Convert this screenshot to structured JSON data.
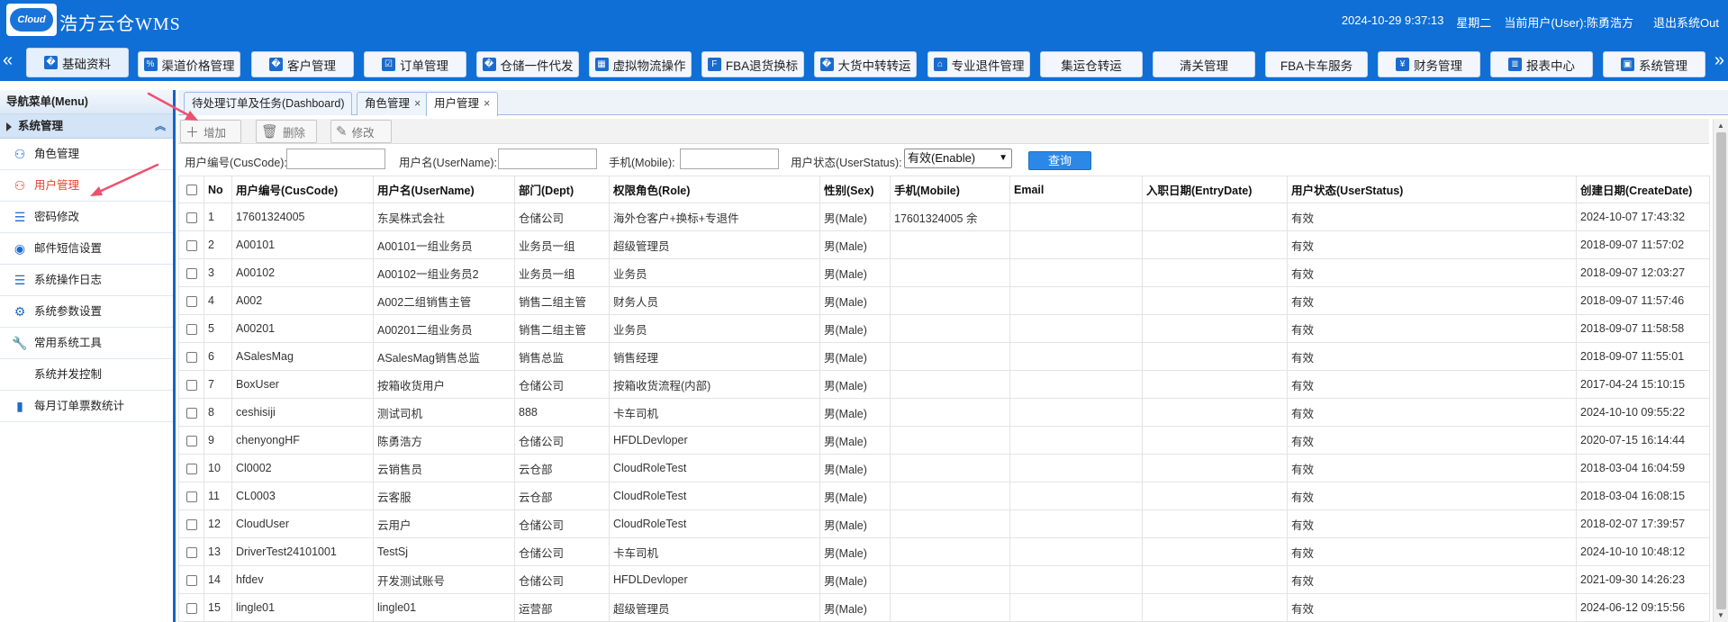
{
  "header": {
    "logo_text": "Cloud",
    "title": "浩方云仓WMS",
    "datetime": "2024-10-29 9:37:13",
    "weekday": "星期二",
    "current_user": "当前用户(User):陈勇浩方",
    "logout": "退出系统Out"
  },
  "topnav": {
    "left_arrow": "«",
    "right_arrow": "»",
    "items": [
      {
        "label": "基础资料",
        "icon": "tag-icon"
      },
      {
        "label": "渠道价格管理",
        "icon": "percent-icon"
      },
      {
        "label": "客户管理",
        "icon": "user-icon"
      },
      {
        "label": "订单管理",
        "icon": "checklist-icon"
      },
      {
        "label": "仓储一件代发",
        "icon": "globe-icon"
      },
      {
        "label": "虚拟物流操作",
        "icon": "grid-icon"
      },
      {
        "label": "FBA退货换标",
        "icon": "fba-icon"
      },
      {
        "label": "大货中转转运",
        "icon": "truck-icon"
      },
      {
        "label": "专业退件管理",
        "icon": "warehouse-icon"
      },
      {
        "label": "集运仓转运",
        "icon": ""
      },
      {
        "label": "清关管理",
        "icon": ""
      },
      {
        "label": "FBA卡车服务",
        "icon": ""
      },
      {
        "label": "财务管理",
        "icon": "finance-icon"
      },
      {
        "label": "报表中心",
        "icon": "database-icon"
      },
      {
        "label": "系统管理",
        "icon": "id-card-icon"
      }
    ]
  },
  "sidebar": {
    "title": "导航菜单(Menu)",
    "group": "系统管理",
    "items": [
      {
        "label": "角色管理",
        "icon": "user-outline-icon"
      },
      {
        "label": "用户管理",
        "icon": "user-outline-icon"
      },
      {
        "label": "密码修改",
        "icon": "list-icon"
      },
      {
        "label": "邮件短信设置",
        "icon": "disk-icon"
      },
      {
        "label": "系统操作日志",
        "icon": "list-icon"
      },
      {
        "label": "系统参数设置",
        "icon": "gear-icon"
      },
      {
        "label": "常用系统工具",
        "icon": "wrench-icon"
      },
      {
        "label": "系统并发控制",
        "icon": ""
      },
      {
        "label": "每月订单票数统计",
        "icon": "bar-chart-icon"
      }
    ]
  },
  "tabs": [
    {
      "label": "待处理订单及任务(Dashboard)",
      "closable": false
    },
    {
      "label": "角色管理",
      "closable": true
    },
    {
      "label": "用户管理",
      "closable": true
    }
  ],
  "toolbar": {
    "add": "增加",
    "delete": "删除",
    "edit": "修改"
  },
  "search": {
    "cuscode_label": "用户编号(CusCode):",
    "cuscode_value": "",
    "username_label": "用户名(UserName):",
    "username_value": "",
    "mobile_label": "手机(Mobile):",
    "mobile_value": "",
    "status_label": "用户状态(UserStatus):",
    "status_selected": "有效(Enable)",
    "query": "查询"
  },
  "table": {
    "columns": [
      "No",
      "用户编号(CusCode)",
      "用户名(UserName)",
      "部门(Dept)",
      "权限角色(Role)",
      "性别(Sex)",
      "手机(Mobile)",
      "Email",
      "入职日期(EntryDate)",
      "用户状态(UserStatus)",
      "创建日期(CreateDate)"
    ],
    "rows": [
      [
        "1",
        "17601324005",
        "东吴株式会社",
        "仓储公司",
        "海外仓客户+换标+专退件",
        "男(Male)",
        "17601324005 余",
        "",
        "",
        "有效",
        "2024-10-07 17:43:32"
      ],
      [
        "2",
        "A00101",
        "A00101一组业务员",
        "业务员一组",
        "超级管理员",
        "男(Male)",
        "",
        "",
        "",
        "有效",
        "2018-09-07 11:57:02"
      ],
      [
        "3",
        "A00102",
        "A00102一组业务员2",
        "业务员一组",
        "业务员",
        "男(Male)",
        "",
        "",
        "",
        "有效",
        "2018-09-07 12:03:27"
      ],
      [
        "4",
        "A002",
        "A002二组销售主管",
        "销售二组主管",
        "财务人员",
        "男(Male)",
        "",
        "",
        "",
        "有效",
        "2018-09-07 11:57:46"
      ],
      [
        "5",
        "A00201",
        "A00201二组业务员",
        "销售二组主管",
        "业务员",
        "男(Male)",
        "",
        "",
        "",
        "有效",
        "2018-09-07 11:58:58"
      ],
      [
        "6",
        "ASalesMag",
        "ASalesMag销售总监",
        "销售总监",
        "销售经理",
        "男(Male)",
        "",
        "",
        "",
        "有效",
        "2018-09-07 11:55:01"
      ],
      [
        "7",
        "BoxUser",
        "按箱收货用户",
        "仓储公司",
        "按箱收货流程(内部)",
        "男(Male)",
        "",
        "",
        "",
        "有效",
        "2017-04-24 15:10:15"
      ],
      [
        "8",
        "ceshisiji",
        "测试司机",
        "888",
        "卡车司机",
        "男(Male)",
        "",
        "",
        "",
        "有效",
        "2024-10-10 09:55:22"
      ],
      [
        "9",
        "chenyongHF",
        "陈勇浩方",
        "仓储公司",
        "HFDLDevloper",
        "男(Male)",
        "",
        "",
        "",
        "有效",
        "2020-07-15 16:14:44"
      ],
      [
        "10",
        "Cl0002",
        "云销售员",
        "云仓部",
        "CloudRoleTest",
        "男(Male)",
        "",
        "",
        "",
        "有效",
        "2018-03-04 16:04:59"
      ],
      [
        "11",
        "CL0003",
        "云客服",
        "云仓部",
        "CloudRoleTest",
        "男(Male)",
        "",
        "",
        "",
        "有效",
        "2018-03-04 16:08:15"
      ],
      [
        "12",
        "CloudUser",
        "云用户",
        "仓储公司",
        "CloudRoleTest",
        "男(Male)",
        "",
        "",
        "",
        "有效",
        "2018-02-07 17:39:57"
      ],
      [
        "13",
        "DriverTest24101001",
        "TestSj",
        "仓储公司",
        "卡车司机",
        "男(Male)",
        "",
        "",
        "",
        "有效",
        "2024-10-10 10:48:12"
      ],
      [
        "14",
        "hfdev",
        "开发测试账号",
        "仓储公司",
        "HFDLDevloper",
        "男(Male)",
        "",
        "",
        "",
        "有效",
        "2021-09-30 14:26:23"
      ],
      [
        "15",
        "lingle01",
        "lingle01",
        "运营部",
        "超级管理员",
        "男(Male)",
        "",
        "",
        "",
        "有效",
        "2024-06-12 09:15:56"
      ]
    ]
  },
  "colors": {
    "brand_blue": "#0f6fd6",
    "active_red": "#e8412c",
    "annotation_arrow": "#f0506e"
  }
}
